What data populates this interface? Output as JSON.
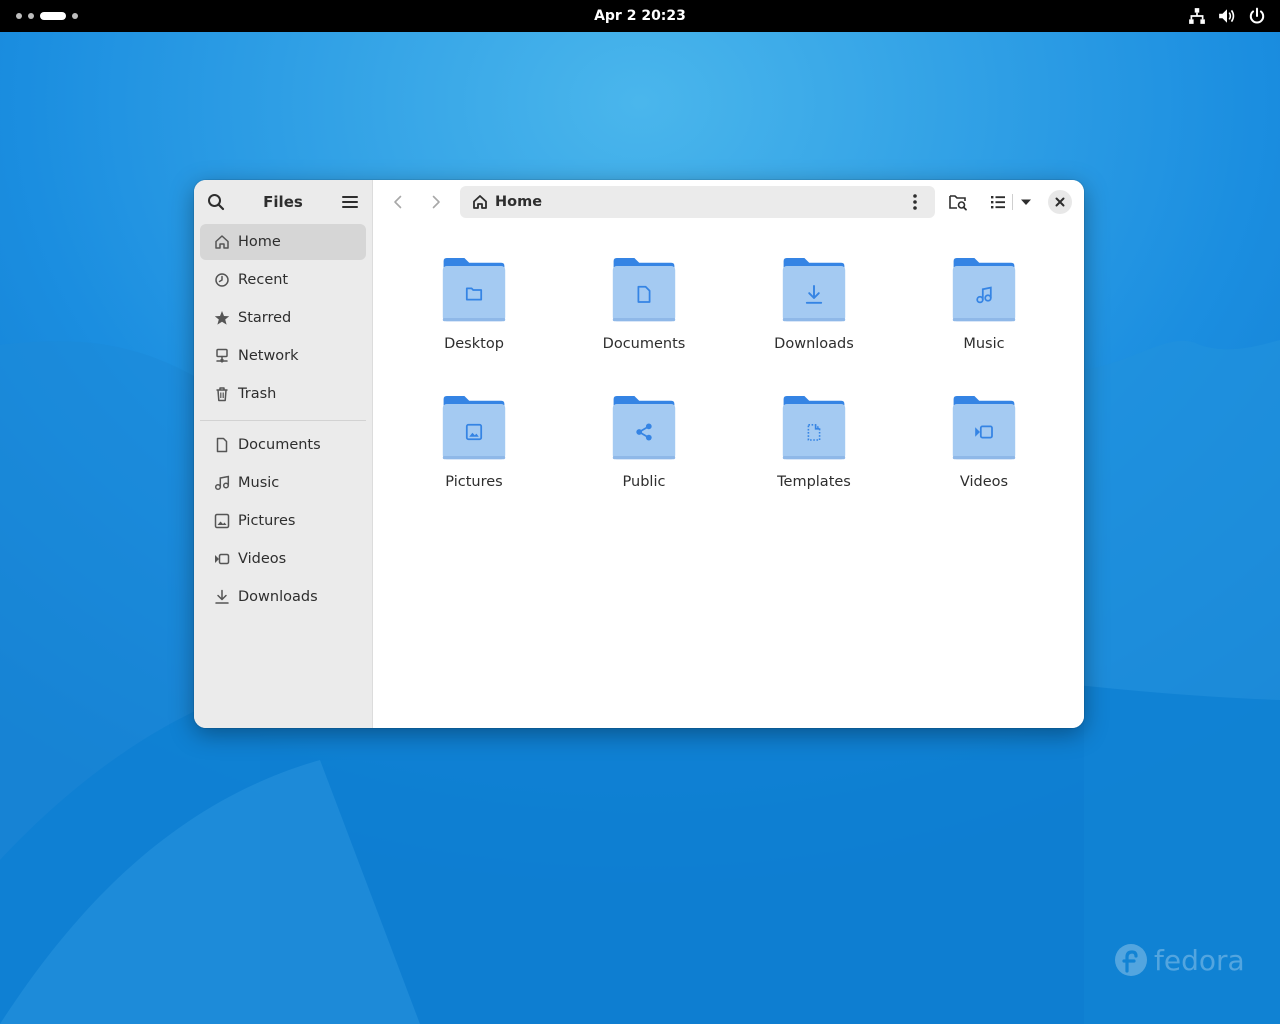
{
  "topbar": {
    "clock": "Apr 2  20:23",
    "tray_icons": [
      "network-wired-icon",
      "volume-icon",
      "power-icon"
    ]
  },
  "window": {
    "sidebar": {
      "title": "Files",
      "items": [
        {
          "label": "Home",
          "icon": "home-icon",
          "active": true
        },
        {
          "label": "Recent",
          "icon": "clock-icon"
        },
        {
          "label": "Starred",
          "icon": "star-icon"
        },
        {
          "label": "Network",
          "icon": "network-icon"
        },
        {
          "label": "Trash",
          "icon": "trash-icon"
        }
      ],
      "places": [
        {
          "label": "Documents",
          "icon": "document-icon"
        },
        {
          "label": "Music",
          "icon": "music-icon"
        },
        {
          "label": "Pictures",
          "icon": "picture-icon"
        },
        {
          "label": "Videos",
          "icon": "video-icon"
        },
        {
          "label": "Downloads",
          "icon": "download-icon"
        }
      ]
    },
    "pathbar": {
      "label": "Home"
    },
    "folders": [
      {
        "label": "Desktop",
        "icon": "folder-emblem-icon"
      },
      {
        "label": "Documents",
        "icon": "document-emblem-icon"
      },
      {
        "label": "Downloads",
        "icon": "download-emblem-icon"
      },
      {
        "label": "Music",
        "icon": "music-emblem-icon"
      },
      {
        "label": "Pictures",
        "icon": "picture-emblem-icon"
      },
      {
        "label": "Public",
        "icon": "share-emblem-icon"
      },
      {
        "label": "Templates",
        "icon": "template-emblem-icon"
      },
      {
        "label": "Videos",
        "icon": "video-emblem-icon"
      }
    ]
  },
  "desktop": {
    "logo_text": "fedora"
  },
  "colors": {
    "folder_back": "#3584e4",
    "folder_front": "#a4caf2",
    "emblem": "#3584e4",
    "desktop": "#1a86d8"
  }
}
